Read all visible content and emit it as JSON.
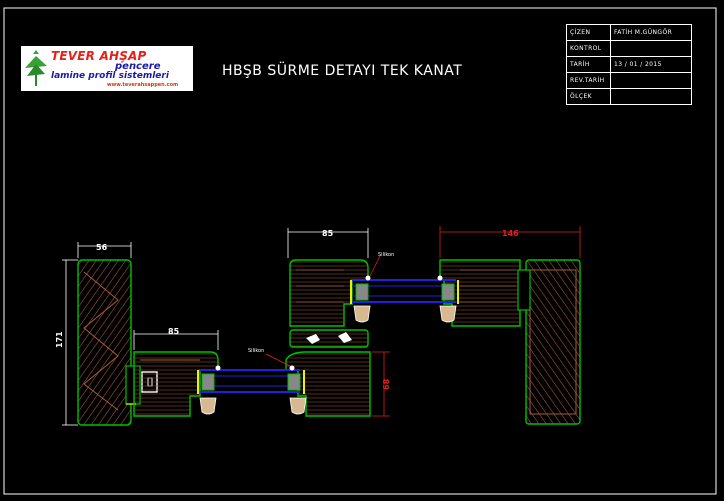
{
  "title": "HBŞB SÜRME DETAYI TEK KANAT",
  "logo": {
    "brand": "TEVER AHŞAP",
    "line1": "pencere",
    "line2": "lamine profil sistemleri",
    "url": "www.teverahsappen.com"
  },
  "title_block": {
    "rows": [
      {
        "label": "ÇİZEN",
        "value": "FATİH M.GÜNGÖR"
      },
      {
        "label": "KONTROL",
        "value": ""
      },
      {
        "label": "TARİH",
        "value": "13 / 01 / 2015"
      },
      {
        "label": "REV.TARİH",
        "value": ""
      },
      {
        "label": "ÖLÇEK",
        "value": ""
      }
    ]
  },
  "dimensions": {
    "left_width": "56",
    "left_height": "171",
    "lower_sash_width": "85",
    "upper_sash_width": "85",
    "right_width": "146",
    "sash_height": "68"
  },
  "notes": {
    "silikon_upper": "Silikon",
    "silikon_lower": "Silikon"
  },
  "colors": {
    "background": "#000000",
    "outline": "#00c000",
    "wood_hatch": "#b06040",
    "glass_line": "#2020e0",
    "gasket": "#9a9a9a",
    "red_dimension": "#e02020",
    "yellow_strip": "#f0f000"
  }
}
